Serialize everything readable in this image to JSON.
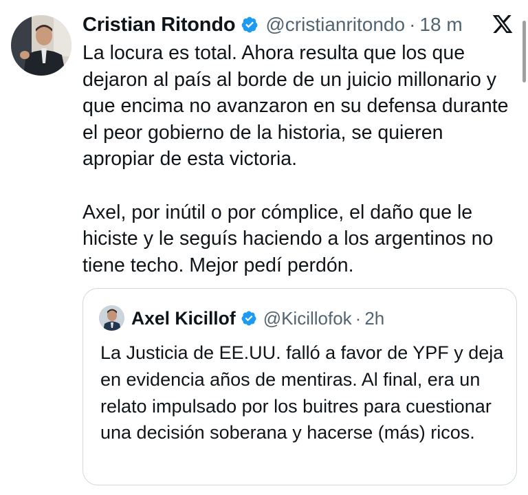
{
  "tweet": {
    "author": {
      "name": "Cristian Ritondo",
      "handle": "@cristianritondo",
      "separator": "·",
      "time": "18 m",
      "verified": true,
      "avatar_icon": "profile-photo"
    },
    "paragraphs": [
      "La locura es total. Ahora resulta que los que dejaron al país al borde de un juicio millonario y que encima no avanzaron en su defensa durante el peor gobierno de la historia, se quieren apropiar de esta victoria.",
      "Axel, por inútil o por cómplice, el daño que le hiciste y le seguís haciendo a los argentinos no tiene techo. Mejor pedí perdón."
    ],
    "platform_icon": "x-logo"
  },
  "quoted_tweet": {
    "author": {
      "name": "Axel Kicillof",
      "handle": "@Kicillofok",
      "separator": "·",
      "time": "2h",
      "verified": true,
      "avatar_icon": "profile-photo"
    },
    "text": "La Justicia de EE.UU. falló a favor de YPF y deja en evidencia años de mentiras. Al final, era un relato impulsado por los buitres para cuestionar una decisión soberana y hacerse (más) ricos."
  },
  "colors": {
    "text_primary": "#0f1419",
    "text_secondary": "#536471",
    "verified_blue": "#1d9bf0",
    "border": "#cfd9de"
  }
}
